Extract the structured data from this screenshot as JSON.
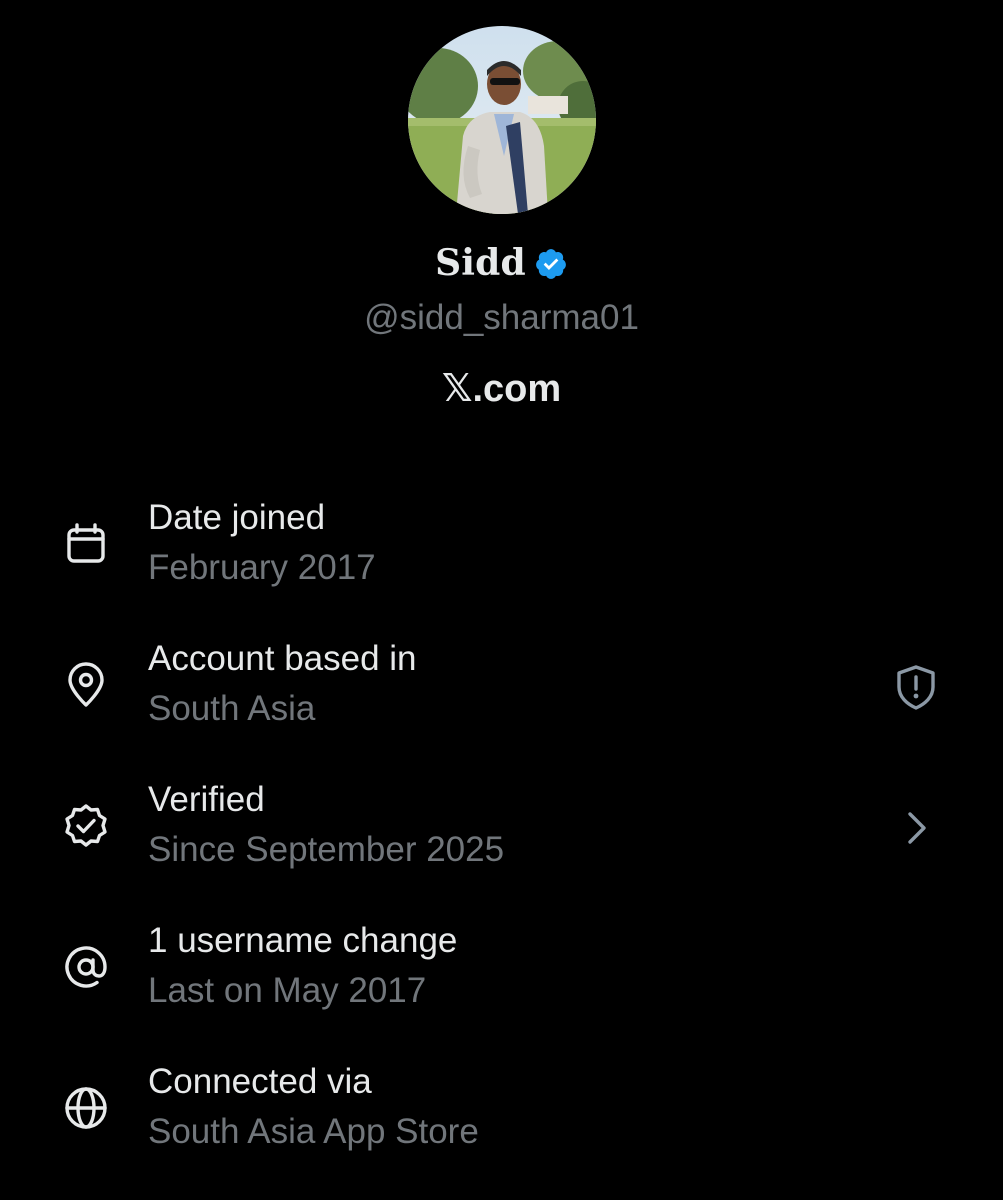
{
  "profile": {
    "display_name": "Sidd",
    "handle": "@sidd_sharma01",
    "platform": "𝕏.com",
    "verified": true,
    "badge_color": "#1d9bf0",
    "avatar_icon": "profile-photo"
  },
  "rows": [
    {
      "title": "Date joined",
      "subtitle": "February 2017",
      "icon": "calendar-icon"
    },
    {
      "title": "Account based in",
      "subtitle": "South Asia",
      "icon": "location-pin-icon",
      "trailing_icon": "shield-alert-icon"
    },
    {
      "title": "Verified",
      "subtitle": "Since September 2025",
      "icon": "verified-check-icon",
      "trailing_icon": "chevron-right-icon"
    },
    {
      "title": "1 username change",
      "subtitle": "Last on May 2017",
      "icon": "at-sign-icon"
    },
    {
      "title": "Connected via",
      "subtitle": "South Asia App Store",
      "icon": "globe-icon"
    }
  ],
  "colors": {
    "background": "#000000",
    "primary_text": "#e7e9ea",
    "secondary_text": "#71767b"
  }
}
